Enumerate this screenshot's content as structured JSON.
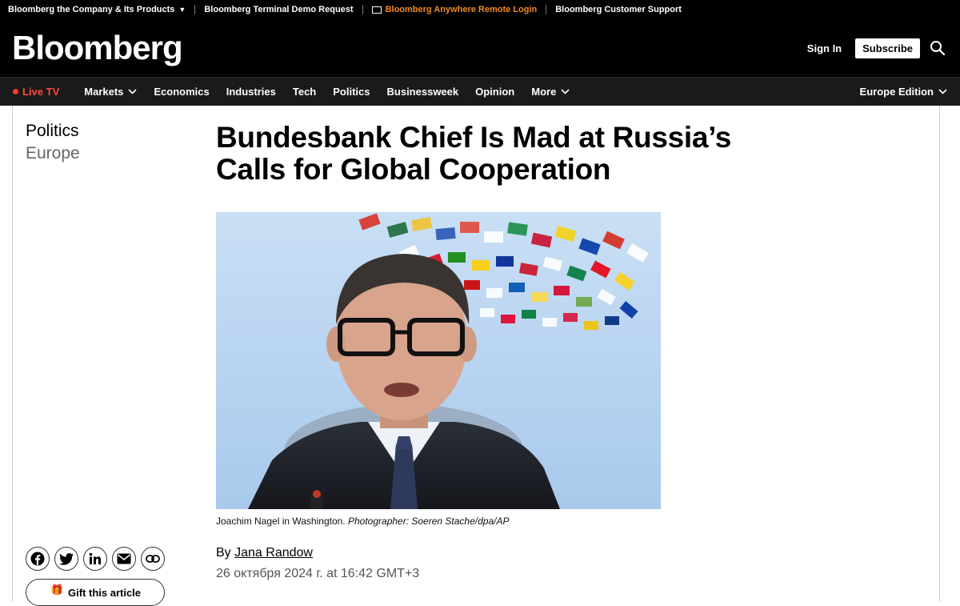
{
  "utility": {
    "company": "Bloomberg the Company & Its Products",
    "terminal_demo": "Bloomberg Terminal Demo Request",
    "anywhere": "Bloomberg Anywhere Remote Login",
    "support": "Bloomberg Customer Support"
  },
  "header": {
    "logo": "Bloomberg",
    "sign_in": "Sign In",
    "subscribe": "Subscribe"
  },
  "nav": {
    "live": "Live TV",
    "items": [
      "Markets",
      "Economics",
      "Industries",
      "Tech",
      "Politics",
      "Businessweek",
      "Opinion",
      "More"
    ],
    "edition": "Europe Edition"
  },
  "article": {
    "section": "Politics",
    "subsection": "Europe",
    "headline_line1": "Bundesbank Chief Is Mad at Russia’s",
    "headline_line2": "Calls for Global Cooperation",
    "caption": "Joachim Nagel in Washington.",
    "credit": "Photographer: Soeren Stache/dpa/AP",
    "by": "By",
    "author": "Jana Randow",
    "date": "26 октября 2024 г. at 16:42 GMT+3",
    "gift": "Gift this article"
  },
  "colors": {
    "live": "#ff4a3d",
    "anywhere": "#f08a24",
    "nav_bg": "#1a1a1a"
  }
}
